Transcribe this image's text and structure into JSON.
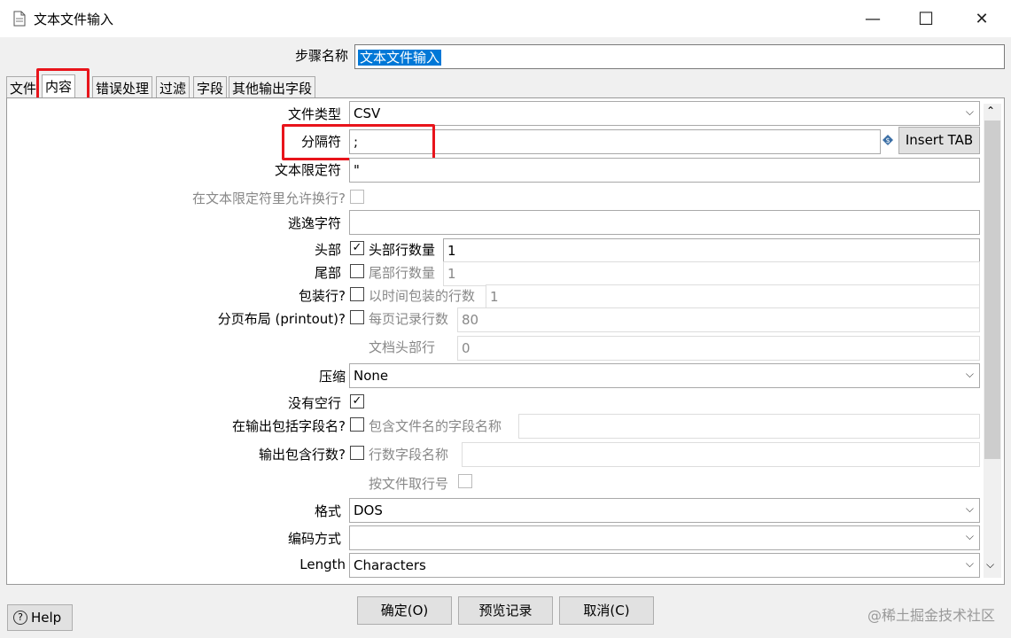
{
  "window": {
    "title": "文本文件输入",
    "min": "—",
    "max": "☐",
    "close": "✕"
  },
  "step": {
    "label": "步骤名称",
    "value": "文本文件输入"
  },
  "tabs": [
    {
      "label": "文件"
    },
    {
      "label": "内容"
    },
    {
      "label": "错误处理"
    },
    {
      "label": "过滤"
    },
    {
      "label": "字段"
    },
    {
      "label": "其他输出字段"
    }
  ],
  "form": {
    "file_type": {
      "label": "文件类型",
      "value": "CSV"
    },
    "separator": {
      "label": "分隔符",
      "value": ";",
      "insert_tab": "Insert TAB"
    },
    "enclosure": {
      "label": "文本限定符",
      "value": "\""
    },
    "allow_breaks": {
      "label": "在文本限定符里允许换行?"
    },
    "escape": {
      "label": "逃逸字符",
      "value": ""
    },
    "header": {
      "label": "头部",
      "checked": true,
      "sub_label": "头部行数量",
      "value": "1"
    },
    "footer": {
      "label": "尾部",
      "checked": false,
      "sub_label": "尾部行数量",
      "value": "1"
    },
    "wrap": {
      "label": "包装行?",
      "checked": false,
      "sub_label": "以时间包装的行数",
      "value": "1"
    },
    "paged": {
      "label": "分页布局 (printout)?",
      "checked": false,
      "sub_label": "每页记录行数",
      "value": "80",
      "doc_header_label": "文档头部行",
      "doc_header_value": "0"
    },
    "compression": {
      "label": "压缩",
      "value": "None"
    },
    "no_empty": {
      "label": "没有空行",
      "checked": true
    },
    "include_filename": {
      "label": "在输出包括字段名?",
      "checked": false,
      "sub_label": "包含文件名的字段名称",
      "value": ""
    },
    "rownum": {
      "label": "输出包含行数?",
      "checked": false,
      "sub_label": "行数字段名称",
      "value": "",
      "by_file_label": "按文件取行号"
    },
    "format": {
      "label": "格式",
      "value": "DOS"
    },
    "encoding": {
      "label": "编码方式",
      "value": ""
    },
    "length": {
      "label": "Length",
      "value": "Characters"
    }
  },
  "buttons": {
    "help": "Help",
    "ok": "确定(O)",
    "preview": "预览记录",
    "cancel": "取消(C)"
  },
  "watermark": "@稀土掘金技术社区",
  "icons": {
    "checkmark": "✓",
    "dropdown": "⌵",
    "help": "?"
  }
}
